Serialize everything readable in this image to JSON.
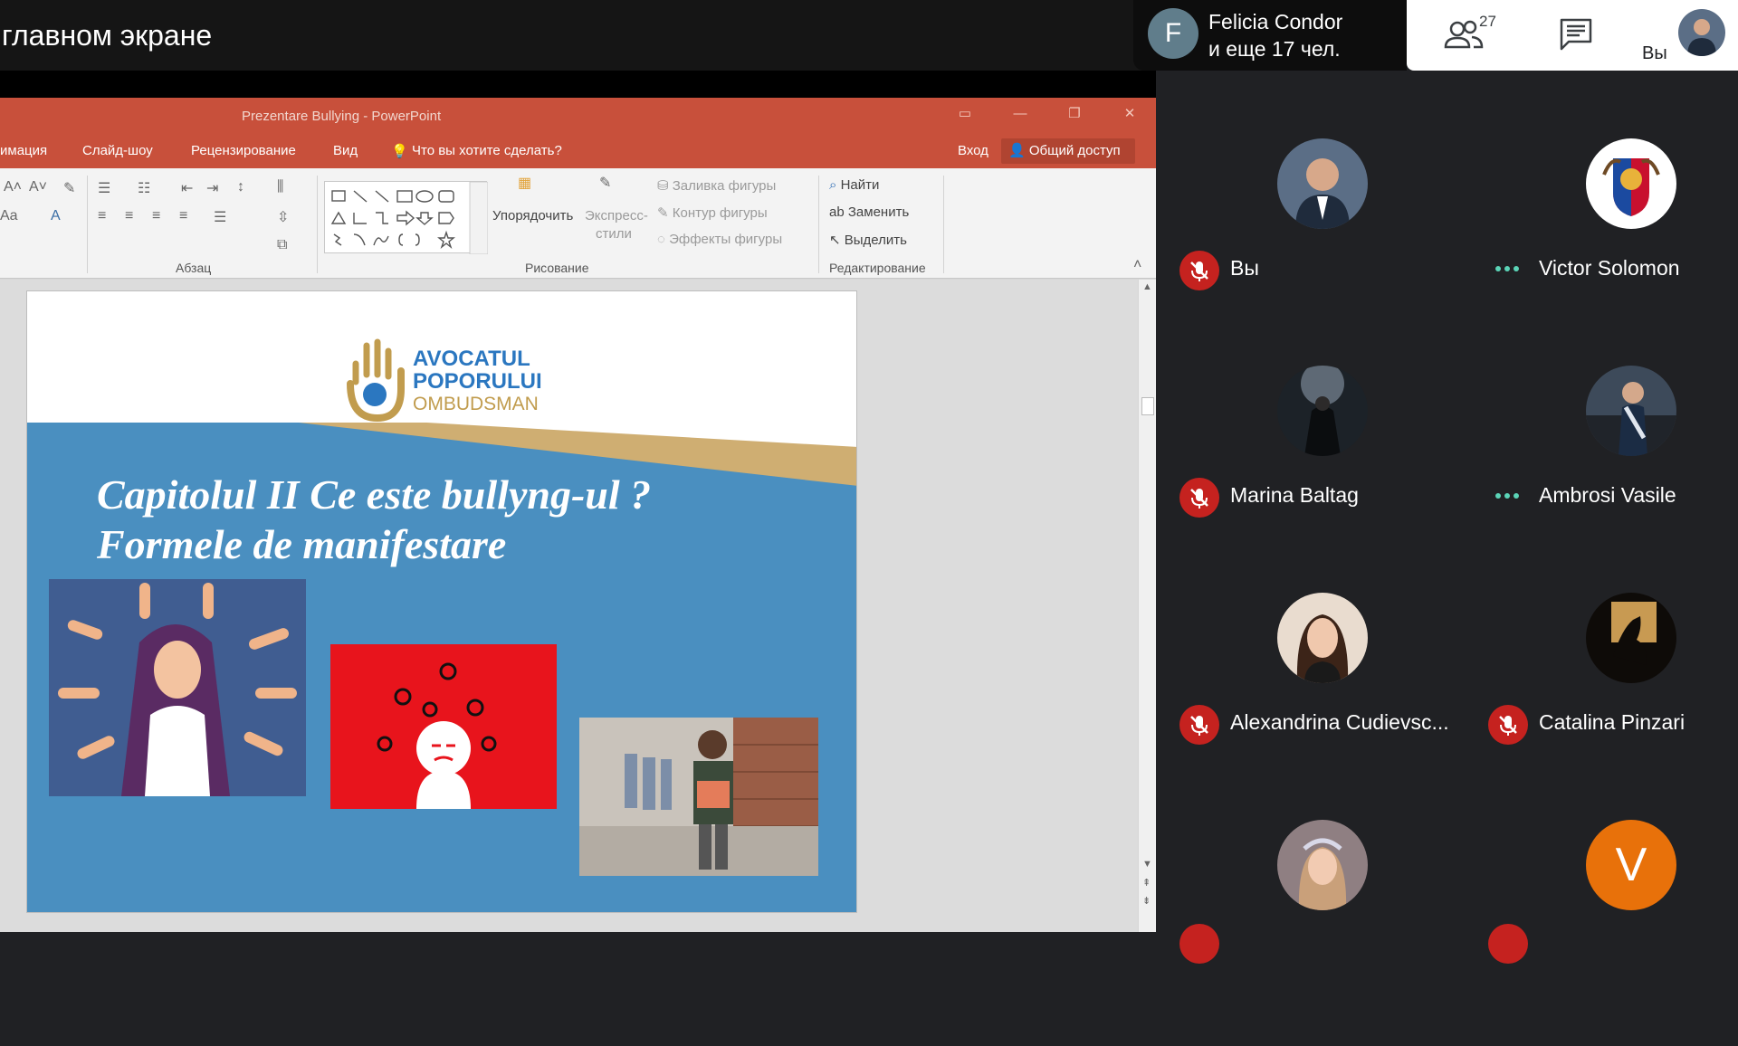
{
  "share": {
    "banner_text": "главном экране"
  },
  "ppt": {
    "window_title": "Prezentare Bullying - PowerPoint",
    "tabs": [
      "имация",
      "Слайд-шоу",
      "Рецензирование",
      "Вид",
      "Что вы хотите сделать?"
    ],
    "signin": "Вход",
    "share_label": "Общий доступ",
    "ribbon": {
      "paragraph_label": "Абзац",
      "drawing_label": "Рисование",
      "editing_label": "Редактирование",
      "arrange": "Упорядочить",
      "quick_styles_1": "Экспресс-",
      "quick_styles_2": "стили",
      "shape_fill": "Заливка фигуры",
      "shape_outline": "Контур фигуры",
      "shape_effects": "Эффекты фигуры",
      "find": "Найти",
      "replace": "Заменить",
      "select": "Выделить"
    },
    "slide": {
      "title_line1": "Capitolul II Ce este bullyng-ul ?",
      "title_line2": "Formele de manifestare",
      "logo_line1": "AVOCATUL",
      "logo_line2": "POPORULUI",
      "logo_line3": "OMBUDSMAN"
    }
  },
  "meet": {
    "presenter_initial": "F",
    "presenter_name_line1": "Felicia Condor",
    "presenter_name_line2": "и еще 17 чел.",
    "participant_count": "27",
    "self_label": "Вы",
    "participants": [
      {
        "name": "Вы",
        "muted": true
      },
      {
        "name": "Victor Solomon",
        "muted": false
      },
      {
        "name": "Marina Baltag",
        "muted": true
      },
      {
        "name": "Ambrosi Vasile",
        "muted": false
      },
      {
        "name": "Alexandrina Cudievsc...",
        "muted": true
      },
      {
        "name": "Catalina Pinzari",
        "muted": true
      },
      {
        "name": "",
        "muted": true
      },
      {
        "name": "",
        "initial": "V",
        "muted": true
      }
    ],
    "colors": {
      "muted_red": "#c5221f",
      "speaking_teal": "#5bd4b7",
      "avatar_orange": "#e8710a"
    }
  }
}
